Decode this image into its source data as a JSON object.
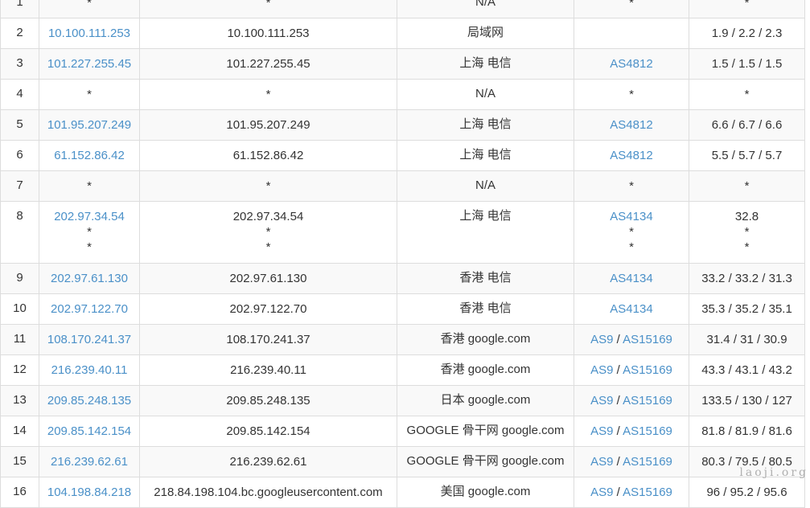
{
  "watermark": "laoji.org",
  "hops": [
    {
      "hop": "1",
      "ip": [
        "*"
      ],
      "host": [
        "*"
      ],
      "loc": "N/A",
      "asn": [
        [
          "*"
        ]
      ],
      "rtt": [
        "*"
      ],
      "ip_link": false
    },
    {
      "hop": "2",
      "ip": [
        "10.100.111.253"
      ],
      "host": [
        "10.100.111.253"
      ],
      "loc": "局域网",
      "asn": [],
      "rtt": [
        "1.9 / 2.2 / 2.3"
      ],
      "ip_link": true
    },
    {
      "hop": "3",
      "ip": [
        "101.227.255.45"
      ],
      "host": [
        "101.227.255.45"
      ],
      "loc": "上海 电信",
      "asn": [
        [
          "AS4812"
        ]
      ],
      "rtt": [
        "1.5 / 1.5 / 1.5"
      ],
      "ip_link": true
    },
    {
      "hop": "4",
      "ip": [
        "*"
      ],
      "host": [
        "*"
      ],
      "loc": "N/A",
      "asn": [
        [
          "*"
        ]
      ],
      "rtt": [
        "*"
      ],
      "ip_link": false
    },
    {
      "hop": "5",
      "ip": [
        "101.95.207.249"
      ],
      "host": [
        "101.95.207.249"
      ],
      "loc": "上海 电信",
      "asn": [
        [
          "AS4812"
        ]
      ],
      "rtt": [
        "6.6 / 6.7 / 6.6"
      ],
      "ip_link": true
    },
    {
      "hop": "6",
      "ip": [
        "61.152.86.42"
      ],
      "host": [
        "61.152.86.42"
      ],
      "loc": "上海 电信",
      "asn": [
        [
          "AS4812"
        ]
      ],
      "rtt": [
        "5.5 / 5.7 / 5.7"
      ],
      "ip_link": true
    },
    {
      "hop": "7",
      "ip": [
        "*"
      ],
      "host": [
        "*"
      ],
      "loc": "N/A",
      "asn": [
        [
          "*"
        ]
      ],
      "rtt": [
        "*"
      ],
      "ip_link": false
    },
    {
      "hop": "8",
      "ip": [
        "202.97.34.54",
        "*",
        "*"
      ],
      "host": [
        "202.97.34.54",
        "*",
        "*"
      ],
      "loc": "上海 电信",
      "asn": [
        [
          "AS4134"
        ],
        [
          "*"
        ],
        [
          "*"
        ]
      ],
      "rtt": [
        "32.8",
        "*",
        "*"
      ],
      "ip_link": true
    },
    {
      "hop": "9",
      "ip": [
        "202.97.61.130"
      ],
      "host": [
        "202.97.61.130"
      ],
      "loc": "香港 电信",
      "asn": [
        [
          "AS4134"
        ]
      ],
      "rtt": [
        "33.2 / 33.2 / 31.3"
      ],
      "ip_link": true
    },
    {
      "hop": "10",
      "ip": [
        "202.97.122.70"
      ],
      "host": [
        "202.97.122.70"
      ],
      "loc": "香港 电信",
      "asn": [
        [
          "AS4134"
        ]
      ],
      "rtt": [
        "35.3 / 35.2 / 35.1"
      ],
      "ip_link": true
    },
    {
      "hop": "11",
      "ip": [
        "108.170.241.37"
      ],
      "host": [
        "108.170.241.37"
      ],
      "loc": "香港 google.com",
      "asn": [
        [
          "AS9",
          "AS15169"
        ]
      ],
      "rtt": [
        "31.4 / 31 / 30.9"
      ],
      "ip_link": true
    },
    {
      "hop": "12",
      "ip": [
        "216.239.40.11"
      ],
      "host": [
        "216.239.40.11"
      ],
      "loc": "香港 google.com",
      "asn": [
        [
          "AS9",
          "AS15169"
        ]
      ],
      "rtt": [
        "43.3 / 43.1 / 43.2"
      ],
      "ip_link": true
    },
    {
      "hop": "13",
      "ip": [
        "209.85.248.135"
      ],
      "host": [
        "209.85.248.135"
      ],
      "loc": "日本 google.com",
      "asn": [
        [
          "AS9",
          "AS15169"
        ]
      ],
      "rtt": [
        "133.5 / 130 / 127"
      ],
      "ip_link": true
    },
    {
      "hop": "14",
      "ip": [
        "209.85.142.154"
      ],
      "host": [
        "209.85.142.154"
      ],
      "loc": "GOOGLE 骨干网 google.com",
      "asn": [
        [
          "AS9",
          "AS15169"
        ]
      ],
      "rtt": [
        "81.8 / 81.9 / 81.6"
      ],
      "ip_link": true
    },
    {
      "hop": "15",
      "ip": [
        "216.239.62.61"
      ],
      "host": [
        "216.239.62.61"
      ],
      "loc": "GOOGLE 骨干网 google.com",
      "asn": [
        [
          "AS9",
          "AS15169"
        ]
      ],
      "rtt": [
        "80.3 / 79.5 / 80.5"
      ],
      "ip_link": true
    },
    {
      "hop": "16",
      "ip": [
        "104.198.84.218"
      ],
      "host": [
        "218.84.198.104.bc.googleusercontent.com"
      ],
      "loc": "美国 google.com",
      "asn": [
        [
          "AS9",
          "AS15169"
        ]
      ],
      "rtt": [
        "96 / 95.2 / 95.6"
      ],
      "ip_link": true
    }
  ]
}
